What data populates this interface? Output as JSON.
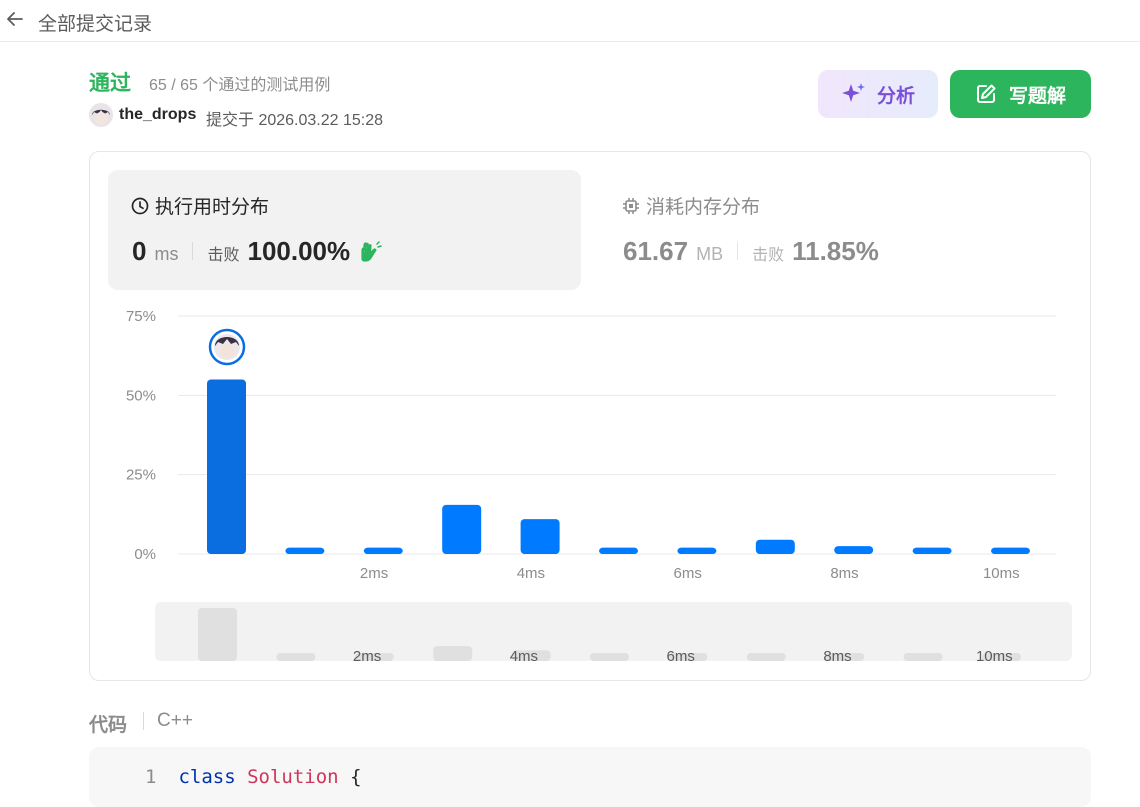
{
  "header": {
    "title": "全部提交记录"
  },
  "submission": {
    "status": "通过",
    "passed_info": "65 / 65 个通过的测试用例",
    "user": "the_drops",
    "submitted_at": "提交于 2026.03.22 15:28"
  },
  "actions": {
    "analyze_label": "分析",
    "solution_label": "写题解"
  },
  "runtime": {
    "title": "执行用时分布",
    "value": "0",
    "unit": "ms",
    "beats_label": "击败",
    "beats_value": "100.00%"
  },
  "memory": {
    "title": "消耗内存分布",
    "value": "61.67",
    "unit": "MB",
    "beats_label": "击败",
    "beats_value": "11.85%"
  },
  "chart_data": {
    "type": "bar",
    "categories": [
      "0ms",
      "1ms",
      "2ms",
      "3ms",
      "4ms",
      "5ms",
      "6ms",
      "7ms",
      "8ms",
      "9ms",
      "10ms"
    ],
    "values": [
      55,
      2,
      2,
      15.5,
      11,
      2,
      2,
      4.5,
      2.5,
      2,
      2
    ],
    "x_tick_labels": [
      "2ms",
      "4ms",
      "6ms",
      "8ms",
      "10ms"
    ],
    "y_tick_labels": [
      "0%",
      "25%",
      "50%",
      "75%"
    ],
    "ylim": [
      0,
      75
    ],
    "grid": true,
    "highlight_index": 0,
    "highlight_color": "#0a6ee0",
    "bar_color": "#007aff"
  },
  "code": {
    "label": "代码",
    "language": "C++",
    "line_number": "1",
    "keyword": "class",
    "class_name": "Solution",
    "brace": " {"
  },
  "colors": {
    "accent_green": "#2db55d",
    "accent_blue": "#007aff",
    "analyze_purple": "#7b4fd6"
  }
}
